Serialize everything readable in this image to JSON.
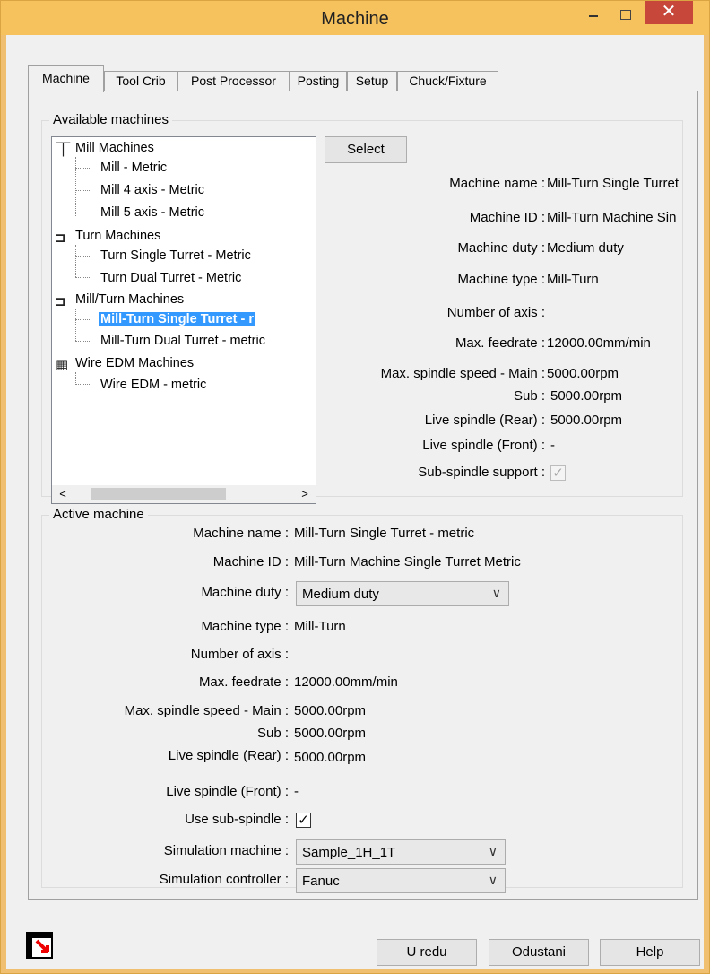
{
  "window": {
    "title": "Machine"
  },
  "tabs": [
    "Machine",
    "Tool Crib",
    "Post Processor",
    "Posting",
    "Setup",
    "Chuck/Fixture"
  ],
  "available": {
    "label": "Available machines",
    "tree": {
      "groups": [
        {
          "label": "Mill Machines",
          "icon": "mill-machine-icon",
          "items": [
            "Mill - Metric",
            "Mill 4 axis - Metric",
            "Mill 5 axis - Metric"
          ]
        },
        {
          "label": "Turn Machines",
          "icon": "turn-machine-icon",
          "items": [
            "Turn Single Turret - Metric",
            "Turn Dual Turret - Metric"
          ]
        },
        {
          "label": "Mill/Turn Machines",
          "icon": "millturn-machine-icon",
          "items": [
            "Mill-Turn Single Turret - metric",
            "Mill-Turn Dual Turret - metric"
          ]
        },
        {
          "label": "Wire EDM Machines",
          "icon": "wire-edm-machine-icon",
          "items": [
            "Wire EDM - metric"
          ]
        }
      ],
      "selected": "Mill-Turn Single Turret - metric",
      "selected_visible": "Mill-Turn Single Turret - r"
    },
    "select_label": "Select",
    "info": {
      "machine_name": {
        "key": "Machine name :",
        "value": "Mill-Turn Single Turret"
      },
      "machine_id": {
        "key": "Machine ID :",
        "value": "Mill-Turn Machine Sin"
      },
      "machine_duty": {
        "key": "Machine duty :",
        "value": "Medium duty"
      },
      "machine_type": {
        "key": "Machine type :",
        "value": "Mill-Turn"
      },
      "num_axis": {
        "key": "Number of axis :",
        "value": ""
      },
      "max_feedrate": {
        "key": "Max. feedrate :",
        "value": "12000.00mm/min"
      },
      "spindle_main": {
        "key": "Max. spindle speed - Main :",
        "value": "5000.00rpm"
      },
      "spindle_sub": {
        "key": "Sub :",
        "value": "5000.00rpm"
      },
      "live_rear": {
        "key": "Live spindle (Rear) :",
        "value": "5000.00rpm"
      },
      "live_front": {
        "key": "Live spindle (Front) :",
        "value": "-"
      },
      "sub_support": {
        "key": "Sub-spindle support :",
        "checked": true
      }
    }
  },
  "active": {
    "label": "Active machine",
    "machine_name": {
      "key": "Machine name :",
      "value": "Mill-Turn Single Turret - metric"
    },
    "machine_id": {
      "key": "Machine ID :",
      "value": "Mill-Turn Machine Single Turret Metric"
    },
    "machine_duty": {
      "key": "Machine duty :",
      "value": "Medium duty"
    },
    "machine_type": {
      "key": "Machine type :",
      "value": "Mill-Turn"
    },
    "num_axis": {
      "key": "Number of axis :",
      "value": ""
    },
    "max_feedrate": {
      "key": "Max. feedrate :",
      "value": "12000.00mm/min"
    },
    "spindle_main": {
      "key": "Max. spindle speed - Main :",
      "value": "5000.00rpm"
    },
    "spindle_sub": {
      "key": "Sub :",
      "value": "5000.00rpm"
    },
    "live_rear": {
      "key": "Live spindle (Rear) :",
      "value": "5000.00rpm"
    },
    "live_front": {
      "key": "Live spindle (Front) :",
      "value": "-"
    },
    "use_sub": {
      "key": "Use sub-spindle :",
      "checked": true
    },
    "sim_machine": {
      "key": "Simulation machine :",
      "value": "Sample_1H_1T"
    },
    "sim_controller": {
      "key": "Simulation controller :",
      "value": "Fanuc"
    }
  },
  "footer": {
    "ok": "U redu",
    "cancel": "Odustani",
    "help": "Help"
  },
  "colors": {
    "titlebar": "#f6c25e",
    "close": "#c7483b",
    "selection": "#3399ff"
  }
}
